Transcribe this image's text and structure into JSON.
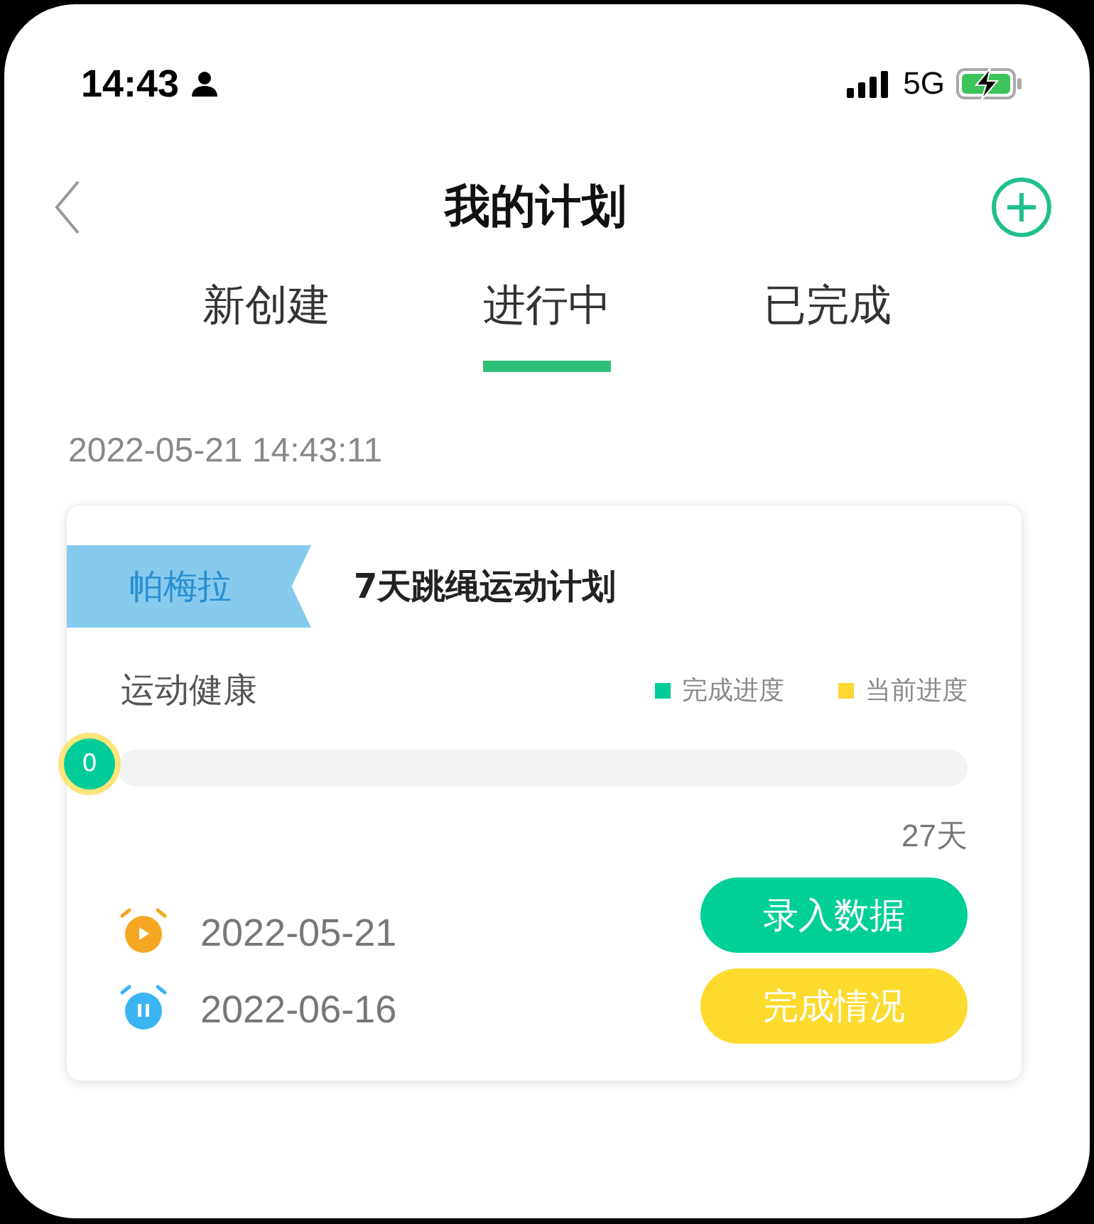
{
  "status_bar": {
    "time": "14:43",
    "network": "5G"
  },
  "nav": {
    "title": "我的计划"
  },
  "tabs": [
    {
      "label": "新创建",
      "selected": false
    },
    {
      "label": "进行中",
      "selected": true
    },
    {
      "label": "已完成",
      "selected": false
    }
  ],
  "timestamp": "2022-05-21 14:43:11",
  "plan_card": {
    "owner": "帕梅拉",
    "title": "7天跳绳运动计划",
    "category": "运动健康",
    "legend": [
      {
        "label": "完成进度",
        "color": "#00cc99"
      },
      {
        "label": "当前进度",
        "color": "#fdd835"
      }
    ],
    "progress": {
      "level": 0,
      "value": "0"
    },
    "duration": "27天",
    "dates": [
      {
        "kind": "start",
        "date": "2022-05-21"
      },
      {
        "kind": "end",
        "date": "2022-06-16"
      }
    ],
    "buttons": [
      {
        "kind": "primary",
        "label": "录入数据"
      },
      {
        "kind": "secondary",
        "label": "完成情况"
      }
    ]
  }
}
